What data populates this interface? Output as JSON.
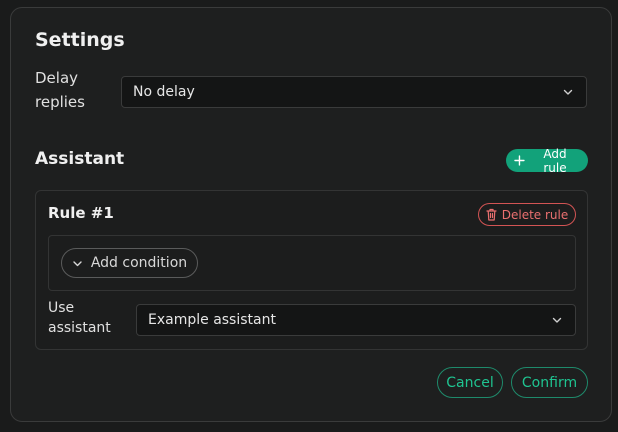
{
  "dialog": {
    "title": "Settings",
    "delay": {
      "label": "Delay replies",
      "value": "No delay"
    },
    "assistant": {
      "section_title": "Assistant",
      "add_rule_label": "Add rule",
      "rules": [
        {
          "title": "Rule #1",
          "delete_label": "Delete rule",
          "add_condition_label": "Add condition",
          "use_assistant_label": "Use assistant",
          "assistant_value": "Example assistant"
        }
      ]
    },
    "footer": {
      "cancel_label": "Cancel",
      "confirm_label": "Confirm"
    }
  },
  "colors": {
    "accent": "#12a27a",
    "accent_text": "#1fc491",
    "danger": "#d25454",
    "background": "#1e1f1f"
  },
  "icons": {
    "add_rule": "plus-icon",
    "delete_rule": "trash-icon",
    "add_condition": "chevron-down-icon",
    "select": "chevron-down-icon"
  }
}
